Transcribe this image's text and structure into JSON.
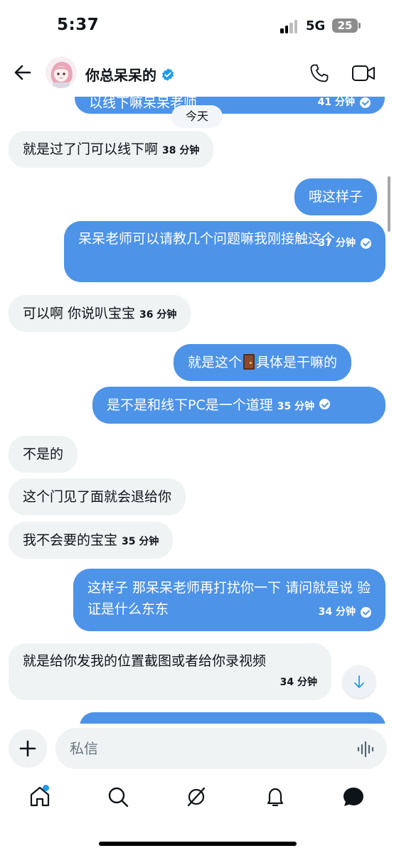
{
  "status_bar": {
    "time": "5:37",
    "network": "5G",
    "battery": "25"
  },
  "header": {
    "title": "你总呆呆的",
    "verified_icon": "verified-badge-icon",
    "accent": "#1d9bf0"
  },
  "divider": {
    "label": "今天"
  },
  "messages": [
    {
      "dir": "out",
      "text": "以线下嘛呆呆老师",
      "time": "41 分钟",
      "read": true
    },
    {
      "dir": "in",
      "text": "就是过了门可以线下啊",
      "time": "38 分钟"
    },
    {
      "dir": "out",
      "text": "哦这样子"
    },
    {
      "dir": "out",
      "text": "呆呆老师可以请教几个问题嘛我刚接触这个",
      "time": "37 分钟",
      "read": true
    },
    {
      "dir": "in",
      "text": "可以啊 你说叭宝宝",
      "time": "36 分钟"
    },
    {
      "dir": "out",
      "text_before": "就是这个",
      "emoji": "door-emoji",
      "text_after": "具体是干嘛的"
    },
    {
      "dir": "out",
      "text": "是不是和线下PC是一个道理",
      "time": "35 分钟",
      "read": true
    },
    {
      "dir": "in",
      "text": "不是的"
    },
    {
      "dir": "in",
      "text": "这个门见了面就会退给你"
    },
    {
      "dir": "in",
      "text": "我不会要的宝宝",
      "time": "35 分钟"
    },
    {
      "dir": "out",
      "text": "这样子 那呆呆老师再打扰你一下 请问就是说 验证是什么东东",
      "time": "34 分钟",
      "read": true
    },
    {
      "dir": "in",
      "text": "就是给你发我的位置截图或者给你录视频",
      "time": "34 分钟"
    }
  ],
  "composer": {
    "placeholder": "私信"
  },
  "colors": {
    "outgoing": "#4d93e8",
    "incoming": "#eff3f4"
  }
}
